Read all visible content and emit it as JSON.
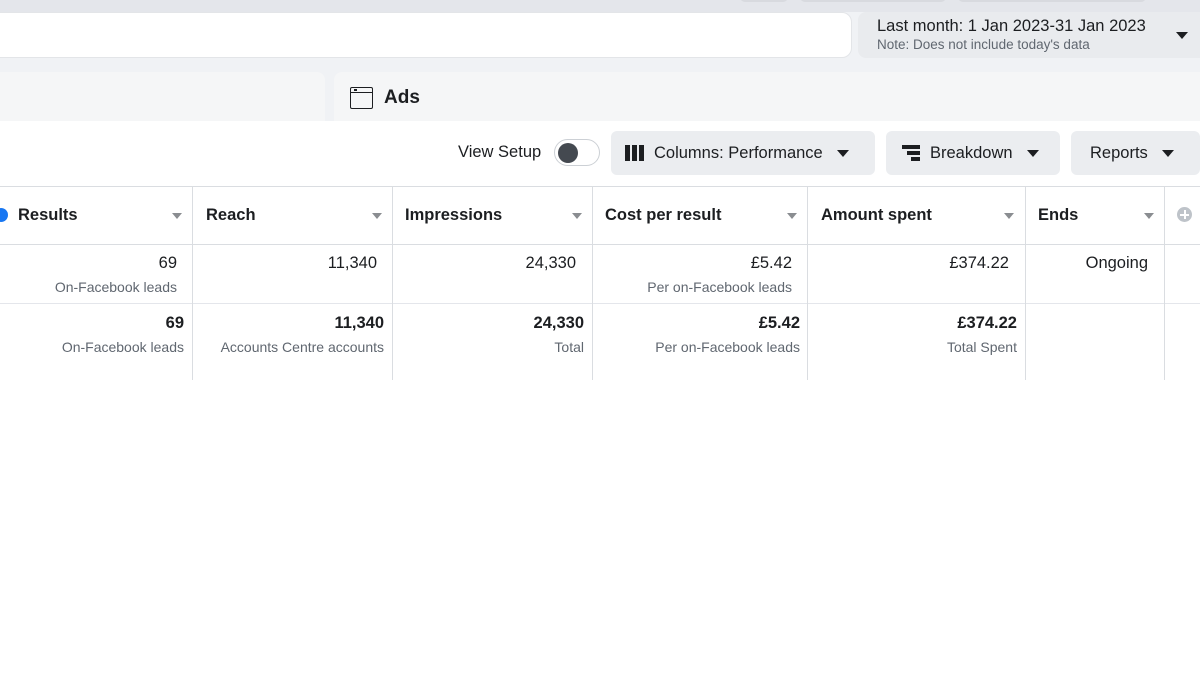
{
  "date_range": {
    "label": "Last month: 1 Jan 2023-31 Jan 2023",
    "note": "Note: Does not include today's data"
  },
  "tabs": {
    "ads_label": "Ads"
  },
  "toolbar": {
    "view_setup_label": "View Setup",
    "view_setup_on": false,
    "columns_label": "Columns: Performance",
    "breakdown_label": "Breakdown",
    "reports_label": "Reports"
  },
  "table": {
    "headers": {
      "results": "Results",
      "reach": "Reach",
      "impressions": "Impressions",
      "cost_per_result": "Cost per result",
      "amount_spent": "Amount spent",
      "ends": "Ends"
    },
    "row": {
      "results": "69",
      "results_sub": "On-Facebook leads",
      "reach": "11,340",
      "impressions": "24,330",
      "cost_per_result": "£5.42",
      "cost_per_result_sub": "Per on-Facebook leads",
      "amount_spent": "£374.22",
      "ends": "Ongoing"
    },
    "totals": {
      "results": "69",
      "results_sub": "On-Facebook leads",
      "reach": "11,340",
      "reach_sub": "Accounts Centre accounts",
      "impressions": "24,330",
      "impressions_sub": "Total",
      "cost_per_result": "£5.42",
      "cost_per_result_sub": "Per on-Facebook leads",
      "amount_spent": "£374.22",
      "amount_spent_sub": "Total Spent"
    }
  },
  "colors": {
    "accent": "#1877f2",
    "button_bg": "#ebedf0"
  }
}
